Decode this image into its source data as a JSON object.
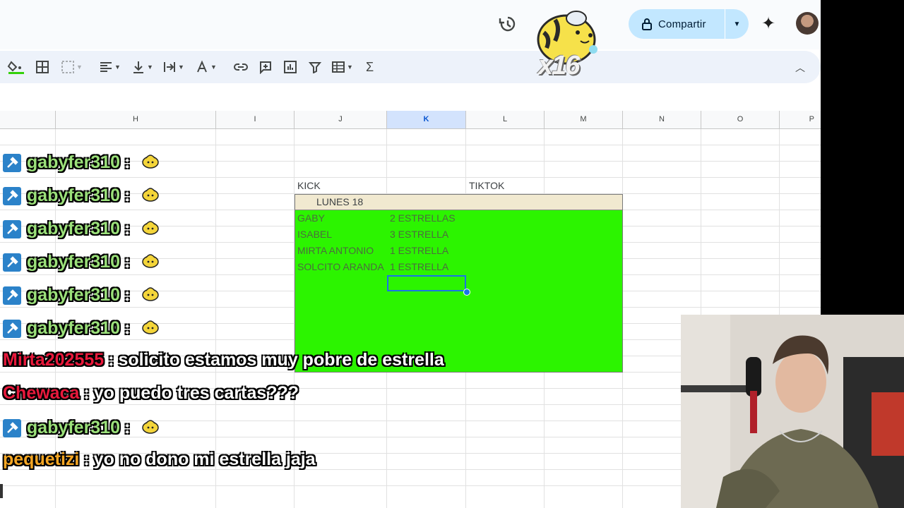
{
  "share": {
    "label": "Compartir"
  },
  "overlay": {
    "multiplier": "x16"
  },
  "columns": [
    {
      "letter": "H",
      "selected": false
    },
    {
      "letter": "I",
      "selected": false
    },
    {
      "letter": "J",
      "selected": false
    },
    {
      "letter": "K",
      "selected": true
    },
    {
      "letter": "L",
      "selected": false
    },
    {
      "letter": "M",
      "selected": false
    },
    {
      "letter": "N",
      "selected": false
    },
    {
      "letter": "O",
      "selected": false
    },
    {
      "letter": "P",
      "selected": false
    }
  ],
  "sheet": {
    "kick": "KICK",
    "tiktok": "TIKTOK",
    "header": "LUNES 18",
    "rows": [
      {
        "name": "GABY",
        "stars": "2 ESTRELLAS"
      },
      {
        "name": "ISABEL",
        "stars": "3 ESTRELLA"
      },
      {
        "name": "MIRTA ANTONIO",
        "stars": "1 ESTRELLA"
      },
      {
        "name": "SOLCITO ARANDA",
        "stars": "1 ESTRELLA"
      }
    ]
  },
  "chat": [
    {
      "user": "gabyfer310",
      "text": "",
      "color": "#9be07a",
      "badge": true,
      "emote": true
    },
    {
      "user": "gabyfer310",
      "text": "",
      "color": "#9be07a",
      "badge": true,
      "emote": true
    },
    {
      "user": "gabyfer310",
      "text": "",
      "color": "#9be07a",
      "badge": true,
      "emote": true
    },
    {
      "user": "gabyfer310",
      "text": "",
      "color": "#9be07a",
      "badge": true,
      "emote": true
    },
    {
      "user": "gabyfer310",
      "text": "",
      "color": "#9be07a",
      "badge": true,
      "emote": true
    },
    {
      "user": "gabyfer310",
      "text": "",
      "color": "#9be07a",
      "badge": true,
      "emote": true
    },
    {
      "user": "Mirta202555",
      "text": "solicito estamos muy pobre de estrella",
      "color": "#e8193c",
      "badge": false,
      "emote": false
    },
    {
      "user": "Chewaca",
      "text": "yo puedo tres cartas???",
      "color": "#e8193c",
      "badge": false,
      "emote": false
    },
    {
      "user": "gabyfer310",
      "text": "",
      "color": "#9be07a",
      "badge": true,
      "emote": true
    },
    {
      "user": "pequetizi",
      "text": "yo no dono mi estrella jaja",
      "color": "#f5a623",
      "badge": false,
      "emote": false
    }
  ],
  "colors": {
    "toolbar": "#edf2fa",
    "share": "#c2e7ff",
    "selected_column": "#d3e3fd",
    "highlight_green": "#2cf400",
    "header_beige": "#f1e9d0"
  }
}
